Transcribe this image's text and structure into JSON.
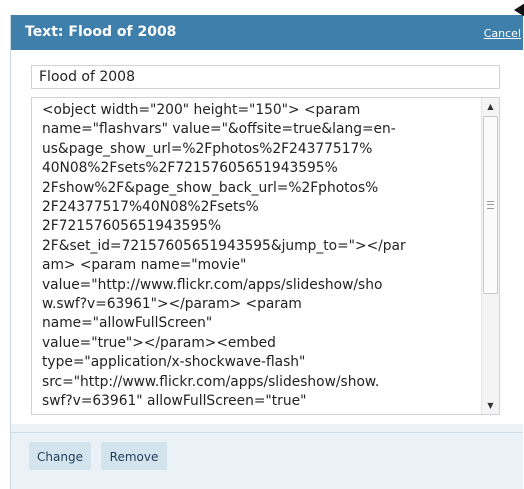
{
  "dialog": {
    "title": "Text: Flood of 2008",
    "cancel_label": "Cancel"
  },
  "form": {
    "title_value": "Flood of 2008",
    "embed_code_lines": [
      "<object width=\"200\" height=\"150\"> <param",
      "name=\"flashvars\" value=\"&offsite=true&lang=en-",
      "us&page_show_url=%2Fphotos%2F24377517%",
      "40N08%2Fsets%2F72157605651943595%",
      "2Fshow%2F&page_show_back_url=%2Fphotos%",
      "2F24377517%40N08%2Fsets%",
      "2F72157605651943595%",
      "2F&set_id=72157605651943595&jump_to=\"></par",
      "am> <param name=\"movie\"",
      "value=\"http://www.flickr.com/apps/slideshow/sho",
      "w.swf?v=63961\"></param> <param",
      "name=\"allowFullScreen\"",
      "value=\"true\"></param><embed",
      "type=\"application/x-shockwave-flash\"",
      "src=\"http://www.flickr.com/apps/slideshow/show.",
      "swf?v=63961\" allowFullScreen=\"true\""
    ]
  },
  "actions": {
    "change_label": "Change",
    "remove_label": "Remove"
  },
  "scrollbar": {
    "up_icon": "triangle-up",
    "down_icon": "triangle-down"
  },
  "colors": {
    "titlebar": "#3f7fac",
    "panel_bg": "#ebf2f7",
    "button_bg": "#d4e4ef"
  }
}
